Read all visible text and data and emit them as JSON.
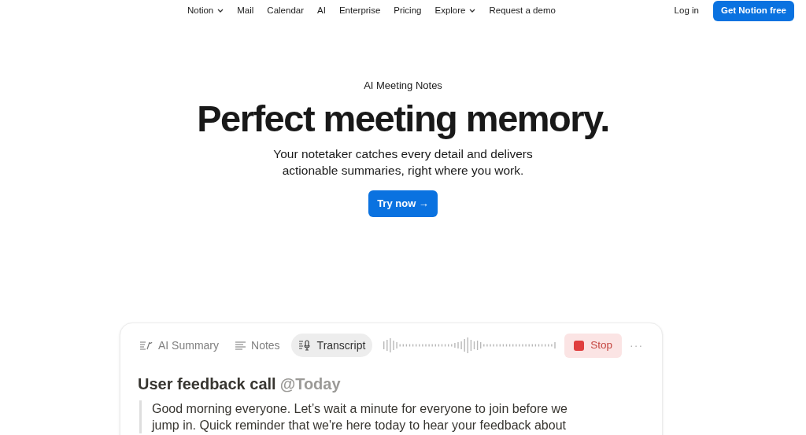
{
  "nav": {
    "links": [
      {
        "label": "Notion",
        "dropdown": true
      },
      {
        "label": "Mail",
        "dropdown": false
      },
      {
        "label": "Calendar",
        "dropdown": false
      },
      {
        "label": "AI",
        "dropdown": false
      },
      {
        "label": "Enterprise",
        "dropdown": false
      },
      {
        "label": "Pricing",
        "dropdown": false
      },
      {
        "label": "Explore",
        "dropdown": true
      },
      {
        "label": "Request a demo",
        "dropdown": false
      }
    ],
    "login": "Log in",
    "cta": "Get Notion free"
  },
  "hero": {
    "eyebrow": "AI Meeting Notes",
    "headline": "Perfect meeting memory.",
    "subhead_lines": [
      "Your notetaker catches every detail and delivers",
      "actionable summaries, right where you work."
    ],
    "button": "Try now →"
  },
  "demo": {
    "tabs": [
      {
        "label": "AI Summary",
        "kind": "summary",
        "selected": false
      },
      {
        "label": "Notes",
        "kind": "notes",
        "selected": false
      },
      {
        "label": "Transcript",
        "kind": "transcript",
        "selected": true
      }
    ],
    "stop": "Stop",
    "more": "···",
    "title": "User feedback call",
    "mention": "@Today",
    "transcript": "Good morning everyone. Let’s wait a minute for everyone to join before we jump in. Quick reminder that we're here today to hear your feedback about"
  }
}
